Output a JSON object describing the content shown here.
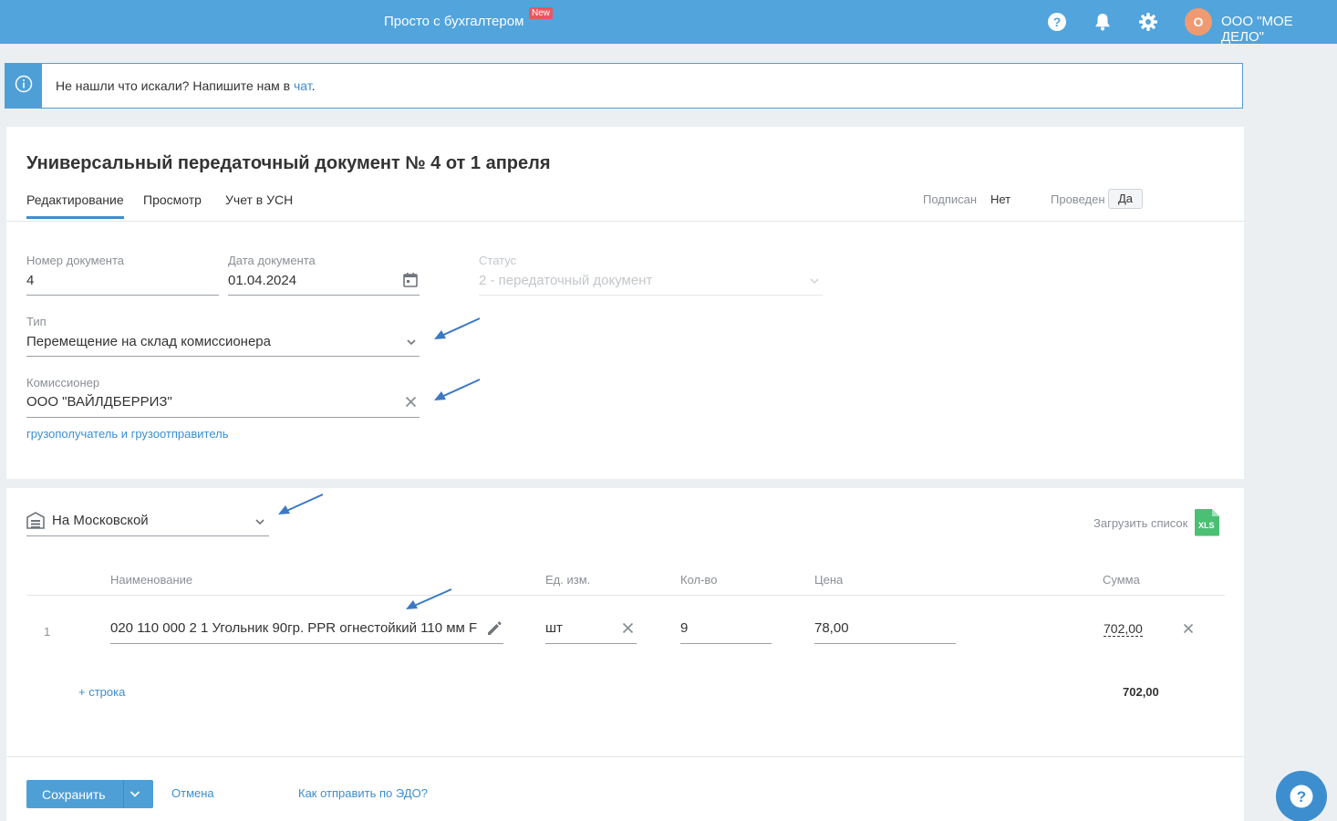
{
  "topbar": {
    "promo": "Просто с бухгалтером",
    "new_badge": "New",
    "avatar_letter": "О",
    "org_name": "ООО \"МОЕ ДЕЛО\""
  },
  "banner": {
    "text": "Не нашли что искали? Напишите нам в ",
    "link": "чат",
    "suffix": "."
  },
  "document": {
    "title": "Универсальный передаточный документ № 4 от 1 апреля",
    "tabs": [
      "Редактирование",
      "Просмотр",
      "Учет в УСН"
    ],
    "signed_label": "Подписан",
    "signed_value": "Нет",
    "posted_label": "Проведен",
    "posted_value": "Да"
  },
  "form": {
    "number_label": "Номер документа",
    "number_value": "4",
    "date_label": "Дата документа",
    "date_value": "01.04.2024",
    "status_label": "Статус",
    "status_value": "2 - передаточный документ",
    "type_label": "Тип",
    "type_value": "Перемещение на склад комиссионера",
    "agent_label": "Комиссионер",
    "agent_value": "ООО \"ВАЙЛДБЕРРИЗ\"",
    "consignee_link": "грузополучатель и грузоотправитель"
  },
  "items": {
    "warehouse": "На Московской",
    "upload_label": "Загрузить список",
    "xls_label": "XLS",
    "headers": [
      "Наименование",
      "Ед. изм.",
      "Кол-во",
      "Цена",
      "Сумма"
    ],
    "rows": [
      {
        "num": "1",
        "name": "020 110 000 2 1 Угольник 90гр. PPR огнестойкий 110 мм F",
        "unit": "шт",
        "qty": "9",
        "price": "78,00",
        "sum": "702,00"
      }
    ],
    "add_row": "+ строка",
    "total": "702,00"
  },
  "footer": {
    "save": "Сохранить",
    "cancel": "Отмена",
    "edo_link": "Как отправить по ЭДО?"
  }
}
